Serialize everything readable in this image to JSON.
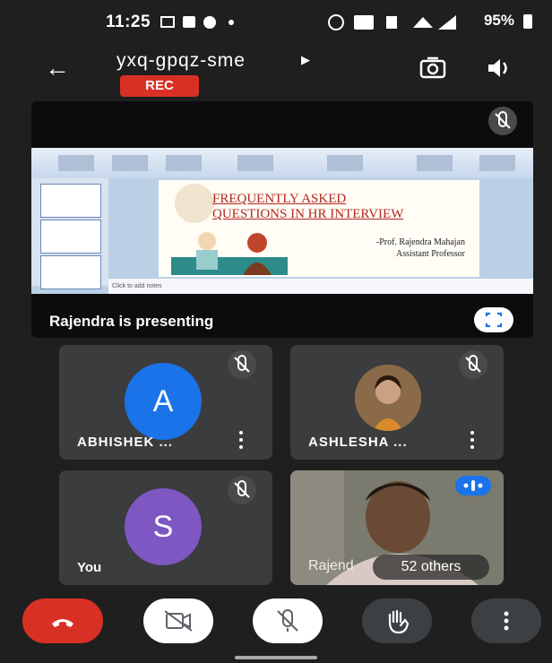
{
  "status_bar": {
    "time": "11:25",
    "battery": "95%"
  },
  "header": {
    "meeting_code": "yxq-gpqz-sme",
    "rec_badge": "REC"
  },
  "presentation": {
    "presenter_label": "Rajendra is presenting",
    "slide_title_line1": "FREQUENTLY ASKED",
    "slide_title_line2": "QUESTIONS IN HR INTERVIEW",
    "slide_author": "-Prof. Rajendra Mahajan",
    "slide_role": "Assistant Professor",
    "notes_placeholder": "Click to add notes"
  },
  "participants": [
    {
      "name": "ABHISHEK ...",
      "initial": "A",
      "color": "#1a73e8"
    },
    {
      "name": "ASHLESHA ..."
    },
    {
      "name": "You",
      "initial": "S",
      "color": "#7e57c2"
    },
    {
      "name": "Rajend",
      "others": "52 others"
    }
  ],
  "icons": [
    "back-arrow-icon",
    "rotate-camera-icon",
    "speaker-icon",
    "mic-off-icon",
    "fullscreen-icon",
    "more-vert-icon",
    "end-call-icon",
    "camera-off-icon",
    "raise-hand-icon",
    "audio-speaking-icon"
  ]
}
